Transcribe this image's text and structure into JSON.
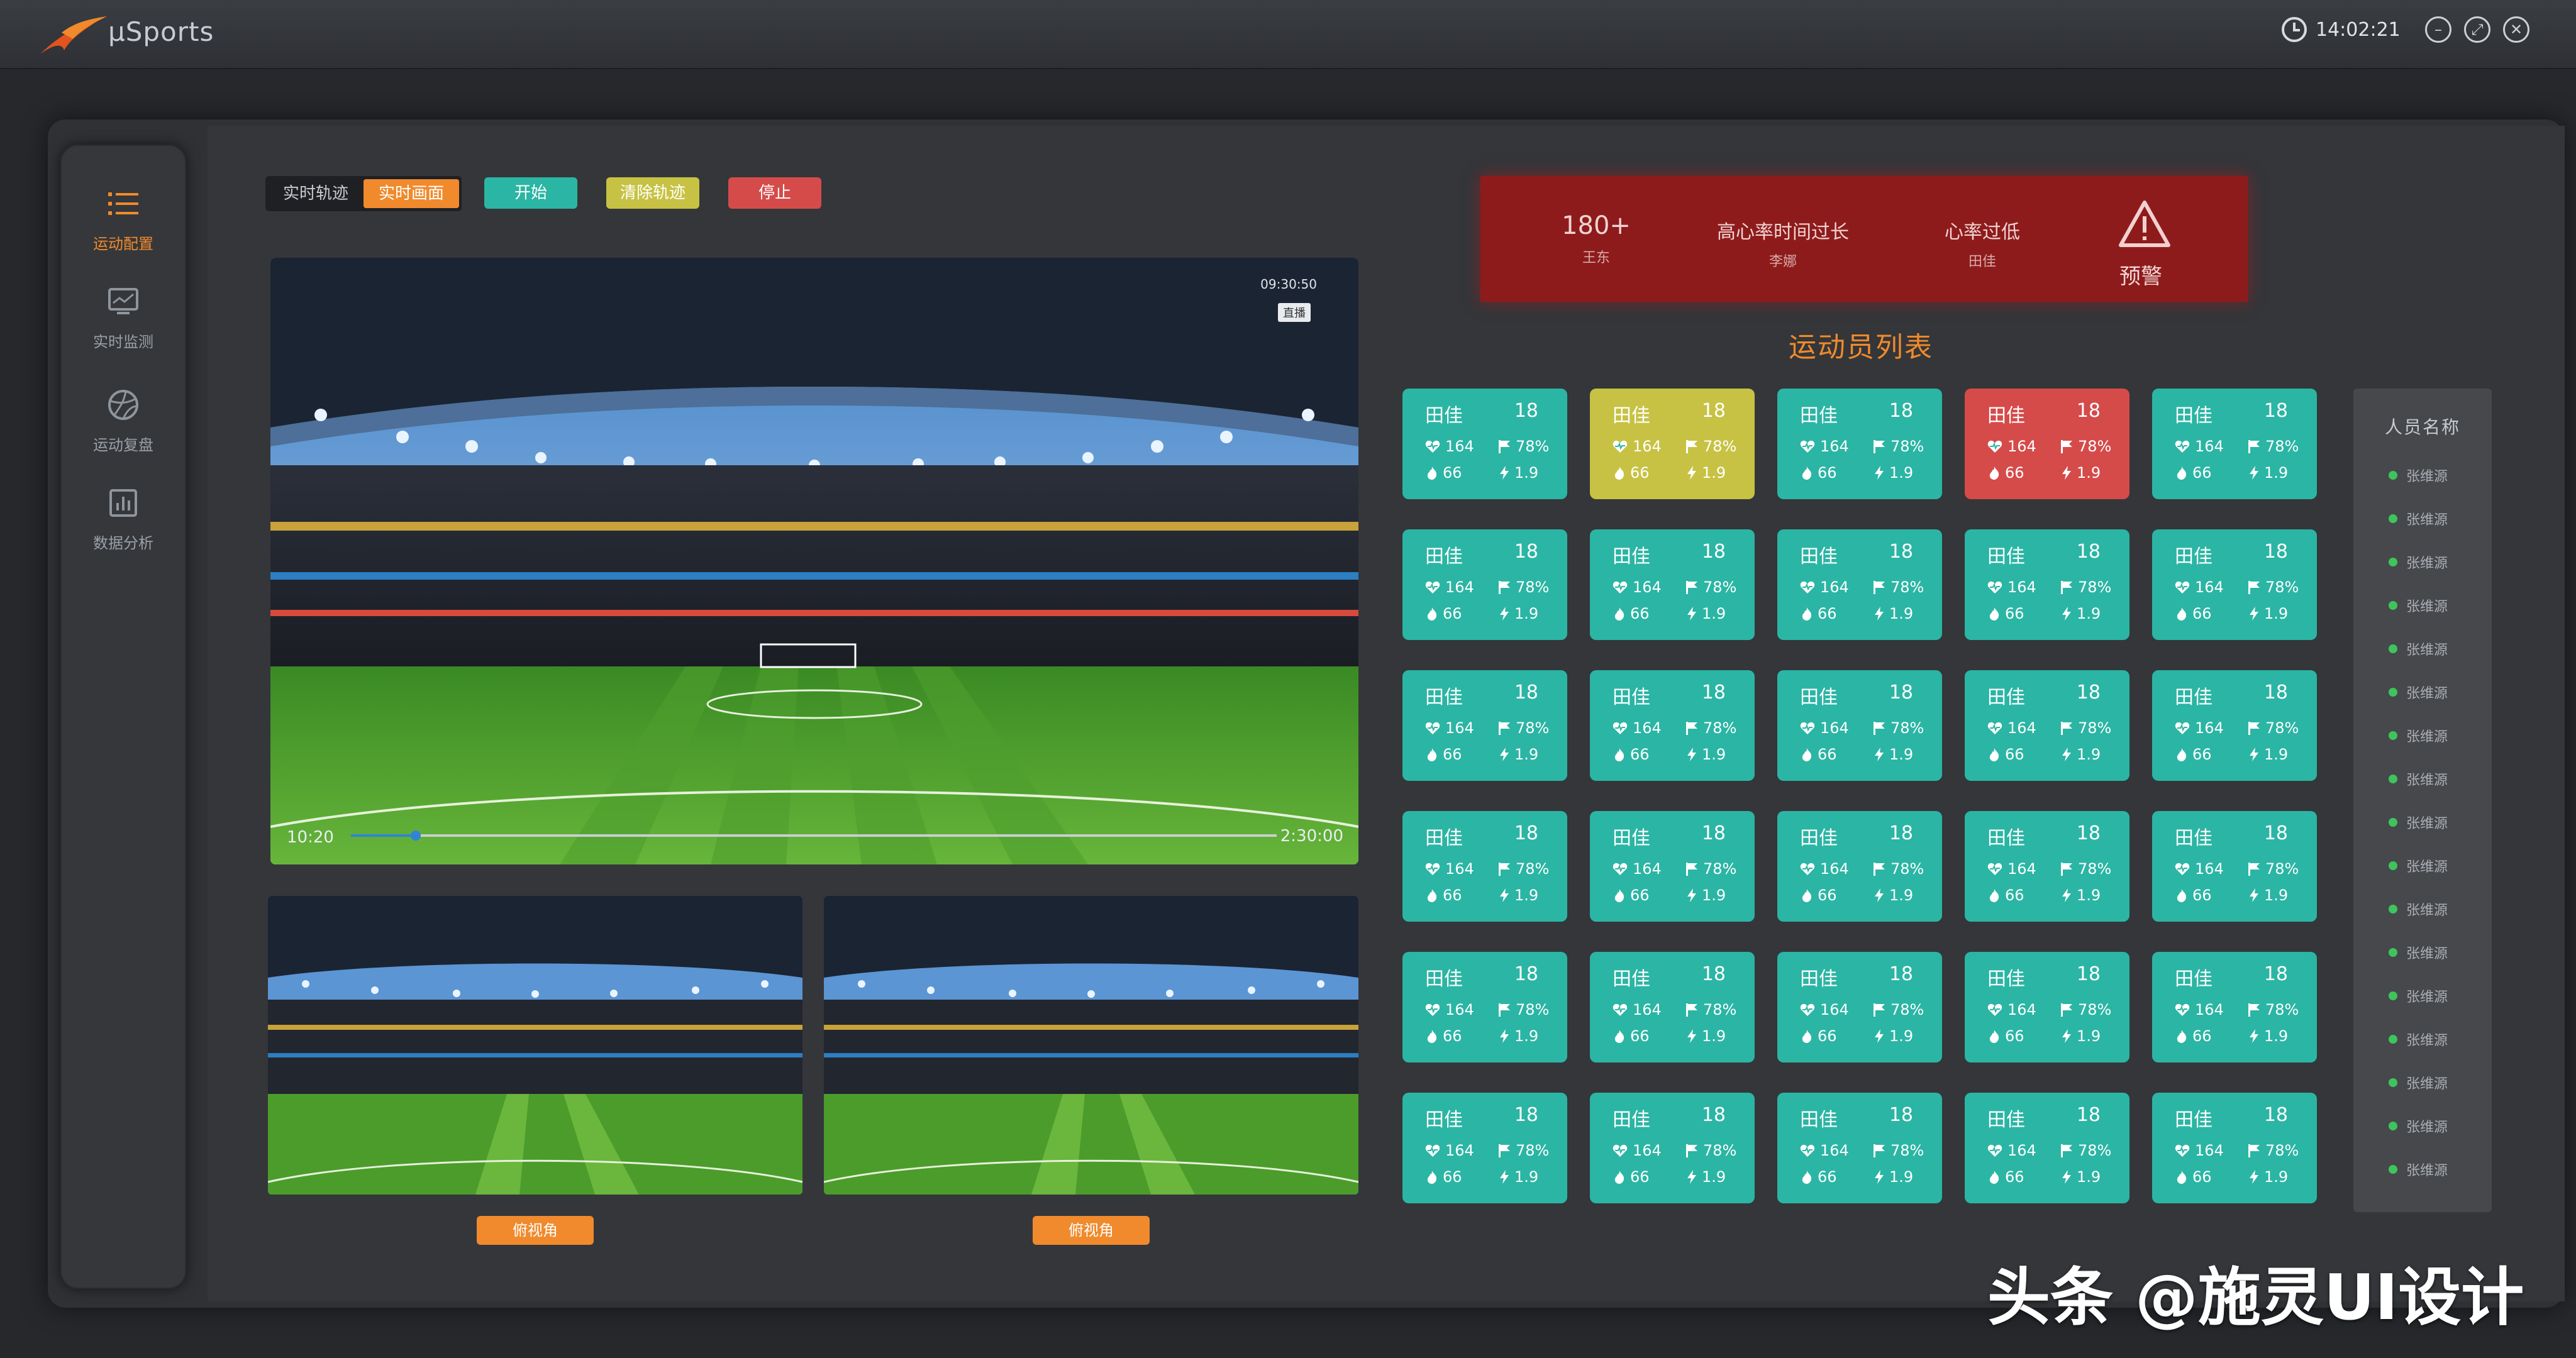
{
  "app": {
    "name": "μSports",
    "time": "14:02:21"
  },
  "sidebar": {
    "items": [
      {
        "label": "运动配置",
        "icon": "list-icon",
        "active": true
      },
      {
        "label": "实时监测",
        "icon": "monitor-icon",
        "active": false
      },
      {
        "label": "运动复盘",
        "icon": "basketball-icon",
        "active": false
      },
      {
        "label": "数据分析",
        "icon": "bar-chart-icon",
        "active": false
      }
    ]
  },
  "controls": {
    "mode_options": [
      "实时轨迹",
      "实时画面"
    ],
    "mode_selected": "实时画面",
    "start": "开始",
    "clear": "清除轨迹",
    "stop": "停止"
  },
  "video": {
    "timestamp": "09:30:50",
    "live_badge": "直播",
    "current": "10:20",
    "total": "2:30:00",
    "progress": 0.07,
    "sub_views": [
      {
        "button": "俯视角"
      },
      {
        "button": "俯视角"
      }
    ]
  },
  "alert": {
    "items": [
      {
        "main": "180+",
        "sub": "王东"
      },
      {
        "main": "高心率时间过长",
        "sub": "李娜"
      },
      {
        "main": "心率过低",
        "sub": "田佳"
      }
    ],
    "label": "预警",
    "icon": "warning-triangle-icon"
  },
  "athlete_list": {
    "title": "运动员列表",
    "cards": [
      {
        "name": "田佳",
        "number": "18",
        "heart": "164",
        "pct": "78%",
        "calories": "66",
        "speed": "1.9",
        "status": "normal"
      },
      {
        "name": "田佳",
        "number": "18",
        "heart": "164",
        "pct": "78%",
        "calories": "66",
        "speed": "1.9",
        "status": "warning"
      },
      {
        "name": "田佳",
        "number": "18",
        "heart": "164",
        "pct": "78%",
        "calories": "66",
        "speed": "1.9",
        "status": "normal"
      },
      {
        "name": "田佳",
        "number": "18",
        "heart": "164",
        "pct": "78%",
        "calories": "66",
        "speed": "1.9",
        "status": "alert"
      },
      {
        "name": "田佳",
        "number": "18",
        "heart": "164",
        "pct": "78%",
        "calories": "66",
        "speed": "1.9",
        "status": "normal"
      },
      {
        "name": "田佳",
        "number": "18",
        "heart": "164",
        "pct": "78%",
        "calories": "66",
        "speed": "1.9",
        "status": "normal"
      },
      {
        "name": "田佳",
        "number": "18",
        "heart": "164",
        "pct": "78%",
        "calories": "66",
        "speed": "1.9",
        "status": "normal"
      },
      {
        "name": "田佳",
        "number": "18",
        "heart": "164",
        "pct": "78%",
        "calories": "66",
        "speed": "1.9",
        "status": "normal"
      },
      {
        "name": "田佳",
        "number": "18",
        "heart": "164",
        "pct": "78%",
        "calories": "66",
        "speed": "1.9",
        "status": "normal"
      },
      {
        "name": "田佳",
        "number": "18",
        "heart": "164",
        "pct": "78%",
        "calories": "66",
        "speed": "1.9",
        "status": "normal"
      },
      {
        "name": "田佳",
        "number": "18",
        "heart": "164",
        "pct": "78%",
        "calories": "66",
        "speed": "1.9",
        "status": "normal"
      },
      {
        "name": "田佳",
        "number": "18",
        "heart": "164",
        "pct": "78%",
        "calories": "66",
        "speed": "1.9",
        "status": "normal"
      },
      {
        "name": "田佳",
        "number": "18",
        "heart": "164",
        "pct": "78%",
        "calories": "66",
        "speed": "1.9",
        "status": "normal"
      },
      {
        "name": "田佳",
        "number": "18",
        "heart": "164",
        "pct": "78%",
        "calories": "66",
        "speed": "1.9",
        "status": "normal"
      },
      {
        "name": "田佳",
        "number": "18",
        "heart": "164",
        "pct": "78%",
        "calories": "66",
        "speed": "1.9",
        "status": "normal"
      },
      {
        "name": "田佳",
        "number": "18",
        "heart": "164",
        "pct": "78%",
        "calories": "66",
        "speed": "1.9",
        "status": "normal"
      },
      {
        "name": "田佳",
        "number": "18",
        "heart": "164",
        "pct": "78%",
        "calories": "66",
        "speed": "1.9",
        "status": "normal"
      },
      {
        "name": "田佳",
        "number": "18",
        "heart": "164",
        "pct": "78%",
        "calories": "66",
        "speed": "1.9",
        "status": "normal"
      },
      {
        "name": "田佳",
        "number": "18",
        "heart": "164",
        "pct": "78%",
        "calories": "66",
        "speed": "1.9",
        "status": "normal"
      },
      {
        "name": "田佳",
        "number": "18",
        "heart": "164",
        "pct": "78%",
        "calories": "66",
        "speed": "1.9",
        "status": "normal"
      },
      {
        "name": "田佳",
        "number": "18",
        "heart": "164",
        "pct": "78%",
        "calories": "66",
        "speed": "1.9",
        "status": "normal"
      },
      {
        "name": "田佳",
        "number": "18",
        "heart": "164",
        "pct": "78%",
        "calories": "66",
        "speed": "1.9",
        "status": "normal"
      },
      {
        "name": "田佳",
        "number": "18",
        "heart": "164",
        "pct": "78%",
        "calories": "66",
        "speed": "1.9",
        "status": "normal"
      },
      {
        "name": "田佳",
        "number": "18",
        "heart": "164",
        "pct": "78%",
        "calories": "66",
        "speed": "1.9",
        "status": "normal"
      },
      {
        "name": "田佳",
        "number": "18",
        "heart": "164",
        "pct": "78%",
        "calories": "66",
        "speed": "1.9",
        "status": "normal"
      },
      {
        "name": "田佳",
        "number": "18",
        "heart": "164",
        "pct": "78%",
        "calories": "66",
        "speed": "1.9",
        "status": "normal"
      },
      {
        "name": "田佳",
        "number": "18",
        "heart": "164",
        "pct": "78%",
        "calories": "66",
        "speed": "1.9",
        "status": "normal"
      },
      {
        "name": "田佳",
        "number": "18",
        "heart": "164",
        "pct": "78%",
        "calories": "66",
        "speed": "1.9",
        "status": "normal"
      },
      {
        "name": "田佳",
        "number": "18",
        "heart": "164",
        "pct": "78%",
        "calories": "66",
        "speed": "1.9",
        "status": "normal"
      },
      {
        "name": "田佳",
        "number": "18",
        "heart": "164",
        "pct": "78%",
        "calories": "66",
        "speed": "1.9",
        "status": "normal"
      }
    ]
  },
  "people": {
    "title": "人员名称",
    "names": [
      "张维源",
      "张维源",
      "张维源",
      "张维源",
      "张维源",
      "张维源",
      "张维源",
      "张维源",
      "张维源",
      "张维源",
      "张维源",
      "张维源",
      "张维源",
      "张维源",
      "张维源",
      "张维源",
      "张维源"
    ]
  },
  "colors": {
    "accent": "#f08a2c",
    "card_normal": "#2bb5a4",
    "card_warning": "#c7c243",
    "card_alert": "#d54b4a",
    "alert_bg": "#8e1b1b",
    "online": "#3ec45b"
  },
  "watermark": "头条 @施灵UI设计"
}
